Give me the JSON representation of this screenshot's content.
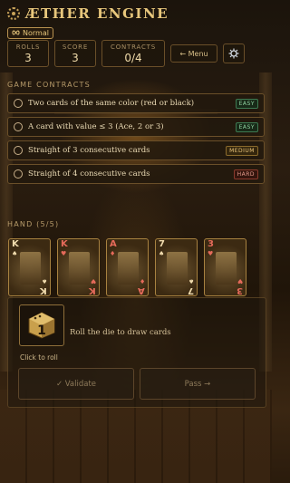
{
  "header": {
    "title": "ÆTHER ENGINE",
    "difficulty": "Normal"
  },
  "stats": [
    {
      "label": "ROLLS",
      "value": "3"
    },
    {
      "label": "SCORE",
      "value": "3"
    },
    {
      "label": "CONTRACTS",
      "value": "0/4"
    }
  ],
  "toolbar": {
    "menu_label": "← Menu"
  },
  "contracts_section": {
    "heading": "GAME CONTRACTS",
    "items": [
      {
        "text": "Two cards of the same color (red or black)",
        "difficulty": "EASY"
      },
      {
        "text": "A card with value ≤ 3 (Ace, 2 or 3)",
        "difficulty": "EASY"
      },
      {
        "text": "Straight of 3 consecutive cards",
        "difficulty": "MEDIUM"
      },
      {
        "text": "Straight of 4 consecutive cards",
        "difficulty": "HARD"
      }
    ]
  },
  "hand": {
    "heading": "HAND (5/5)",
    "cards": [
      {
        "rank": "K",
        "suit": "♠",
        "color": "black"
      },
      {
        "rank": "K",
        "suit": "♥",
        "color": "red"
      },
      {
        "rank": "A",
        "suit": "♦",
        "color": "red"
      },
      {
        "rank": "7",
        "suit": "♠",
        "color": "black"
      },
      {
        "rank": "3",
        "suit": "♥",
        "color": "red"
      }
    ]
  },
  "dice": {
    "face": "1",
    "prompt": "Roll the die to draw cards",
    "hint": "Click to roll"
  },
  "actions": {
    "validate_label": "✓ Validate",
    "pass_label": "Pass →"
  },
  "colors": {
    "accent": "#e8c77c",
    "easy": "#8fd2a0",
    "medium": "#e9c47a",
    "hard": "#e59a8b"
  }
}
